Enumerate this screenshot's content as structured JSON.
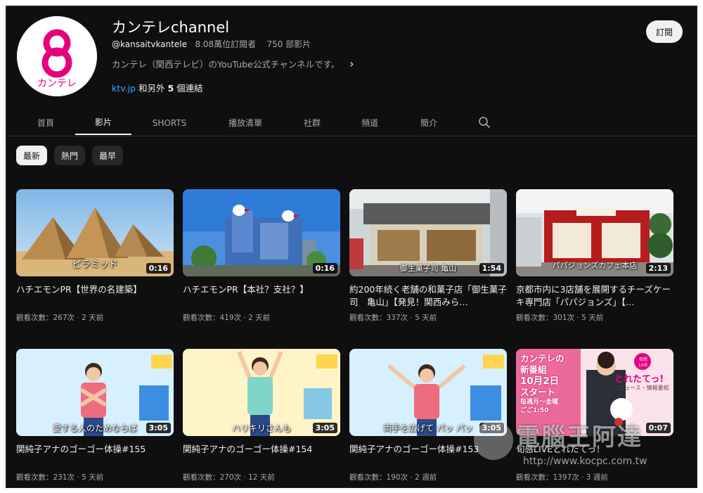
{
  "channel": {
    "name": "カンテレchannel",
    "handle": "@kansaitvkantele",
    "subscribers": "8.08萬位訂閱者",
    "video_count": "750 部影片",
    "description": "カンテレ（関西テレビ）のYouTube公式チャンネルです。",
    "link_primary": "ktv.jp",
    "link_more": "和另外",
    "link_more_count": "5",
    "link_more_suffix": "個連結",
    "logo_text": "カンテレ",
    "subscribe_label": "訂閱"
  },
  "tabs": [
    {
      "label": "首頁"
    },
    {
      "label": "影片",
      "active": true
    },
    {
      "label": "SHORTS"
    },
    {
      "label": "播放清單"
    },
    {
      "label": "社群"
    },
    {
      "label": "頻道"
    },
    {
      "label": "簡介"
    }
  ],
  "chips": [
    {
      "label": "最新",
      "active": true
    },
    {
      "label": "熱門"
    },
    {
      "label": "最早"
    }
  ],
  "videos": [
    {
      "title": "ハチエモンPR【世界の名建築】",
      "views": "觀看次數：267次",
      "age": "2 天前",
      "duration": "0:16",
      "overlay": "ピラミッド",
      "icon": "pyramids-thumbnail"
    },
    {
      "title": "ハチエモンPR【本社？支社？】",
      "views": "觀看次數：419次",
      "age": "2 天前",
      "duration": "0:16",
      "overlay": "",
      "icon": "building-thumbnail"
    },
    {
      "title": "約200年続く老舗の和菓子店「御生菓子司　亀山」【発見！関西みら…",
      "views": "觀看次數：337次",
      "age": "5 天前",
      "duration": "1:54",
      "overlay": "御生菓子司 亀山",
      "icon": "shop-thumbnail"
    },
    {
      "title": "京都市内に3店舗を展開するチーズケーキ専門店「パパジョンズ」【…",
      "views": "觀看次數：301次",
      "age": "5 天前",
      "duration": "2:13",
      "overlay": "パパジョンズカフェ本店",
      "icon": "cafe-thumbnail"
    },
    {
      "title": "関純子アナのゴーゴー体操#155",
      "views": "觀看次數：231次",
      "age": "5 天前",
      "duration": "3:05",
      "overlay": "愛する人のためならば",
      "icon": "exercise-thumbnail"
    },
    {
      "title": "関純子アナのゴーゴー体操#154",
      "views": "觀看次數：270次",
      "age": "12 天前",
      "duration": "3:05",
      "overlay": "ハリキリさんも",
      "icon": "exercise-thumbnail"
    },
    {
      "title": "関純子アナのゴーゴー体操#153",
      "views": "觀看次數：190次",
      "age": "2 週前",
      "duration": "3:05",
      "overlay": "両手を広げて パッ パッ",
      "icon": "exercise-thumbnail"
    },
    {
      "title": "旬感LIVEとれたてっ！",
      "views": "觀看次數：1397次",
      "age": "3 週前",
      "duration": "0:07",
      "overlay": "",
      "icon": "news-program-thumbnail",
      "promo": {
        "line1": "カンテレの",
        "line2": "新番組",
        "line3": "10月2日",
        "line4": "スタート",
        "line5": "毎週月～金曜",
        "line6": "ごご1:50",
        "show": "とれたてっ!",
        "show_sub": "ニュース・情報番組",
        "badge": "旬感LIVE"
      }
    }
  ],
  "watermark": {
    "text": "電腦王阿達",
    "url": "http://www.kocpc.com.tw"
  },
  "colors": {
    "background": "#0f0f0f",
    "text": "#f1f1f1",
    "secondary": "#aaaaaa",
    "link": "#3ea6ff",
    "brand_pink": "#e6007e"
  }
}
